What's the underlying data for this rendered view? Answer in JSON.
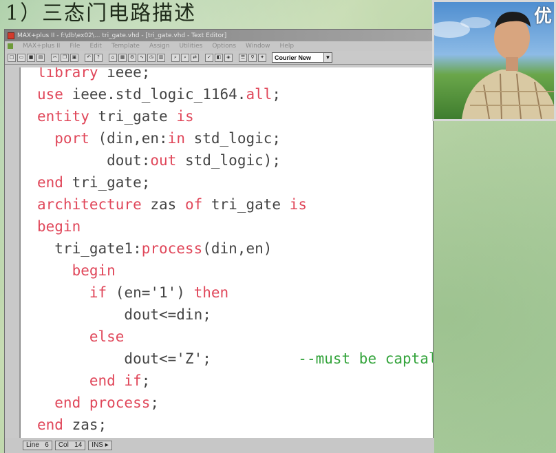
{
  "slide": {
    "title": "1）三态门电路描述"
  },
  "window": {
    "title": "MAX+plus II - f:\\db\\ex02\\... tri_gate.vhd - [tri_gate.vhd - Text Editor]",
    "menus": [
      "MAX+plus II",
      "File",
      "Edit",
      "Template",
      "Assign",
      "Utilities",
      "Options",
      "Window",
      "Help"
    ],
    "font_select": "Courier New"
  },
  "code": {
    "lines": [
      [
        {
          "t": "library ",
          "c": "kw"
        },
        {
          "t": "ieee;",
          "c": "id"
        }
      ],
      [
        {
          "t": "use ",
          "c": "kw"
        },
        {
          "t": "ieee.std_logic_1164.",
          "c": "id"
        },
        {
          "t": "all",
          "c": "kw"
        },
        {
          "t": ";",
          "c": "id"
        }
      ],
      [
        {
          "t": "entity ",
          "c": "kw"
        },
        {
          "t": "tri_gate ",
          "c": "id"
        },
        {
          "t": "is",
          "c": "kw"
        }
      ],
      [
        {
          "t": "  port ",
          "c": "kw"
        },
        {
          "t": "(din,en:",
          "c": "id"
        },
        {
          "t": "in",
          "c": "kw"
        },
        {
          "t": " std_logic;",
          "c": "id"
        }
      ],
      [
        {
          "t": "        dout:",
          "c": "id"
        },
        {
          "t": "out",
          "c": "kw"
        },
        {
          "t": " std_logic);",
          "c": "id"
        }
      ],
      [
        {
          "t": "end ",
          "c": "kw"
        },
        {
          "t": "tri_gate;",
          "c": "id"
        }
      ],
      [
        {
          "t": "architecture ",
          "c": "kw"
        },
        {
          "t": "zas ",
          "c": "id"
        },
        {
          "t": "of ",
          "c": "kw"
        },
        {
          "t": "tri_gate ",
          "c": "id"
        },
        {
          "t": "is",
          "c": "kw"
        }
      ],
      [
        {
          "t": "begin",
          "c": "kw"
        }
      ],
      [
        {
          "t": "  tri_gate1:",
          "c": "id"
        },
        {
          "t": "process",
          "c": "kw"
        },
        {
          "t": "(din,en)",
          "c": "id"
        }
      ],
      [
        {
          "t": "    begin",
          "c": "kw"
        }
      ],
      [
        {
          "t": "      if ",
          "c": "kw"
        },
        {
          "t": "(en='1') ",
          "c": "id"
        },
        {
          "t": "then",
          "c": "kw"
        }
      ],
      [
        {
          "t": "          dout<=din;",
          "c": "id"
        }
      ],
      [
        {
          "t": "      else",
          "c": "kw"
        }
      ],
      [
        {
          "t": "          dout<='Z';",
          "c": "id"
        },
        {
          "t": "          --must be captal",
          "c": "cm"
        }
      ],
      [
        {
          "t": "      end if",
          "c": "kw"
        },
        {
          "t": ";",
          "c": "id"
        }
      ],
      [
        {
          "t": "  end process",
          "c": "kw"
        },
        {
          "t": ";",
          "c": "id"
        }
      ],
      [
        {
          "t": "end ",
          "c": "kw"
        },
        {
          "t": "zas;",
          "c": "id"
        }
      ]
    ]
  },
  "status": {
    "line_label": "Line",
    "line_value": "6",
    "col_label": "Col",
    "col_value": "14",
    "mode": "INS"
  },
  "video": {
    "watermark": "优"
  }
}
